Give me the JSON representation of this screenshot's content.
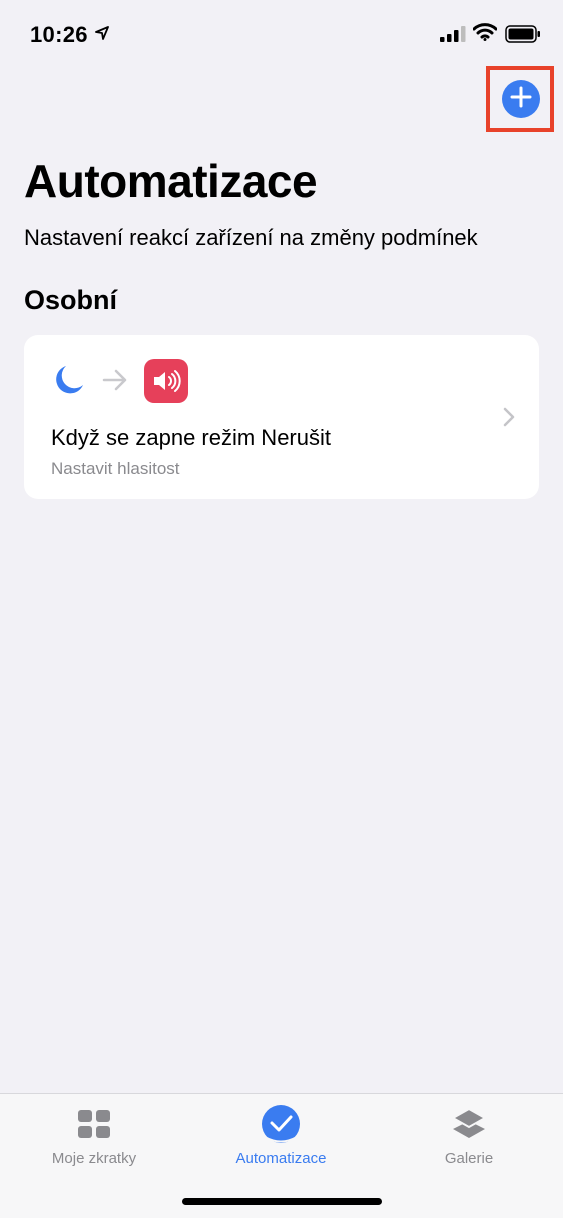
{
  "status_bar": {
    "time": "10:26"
  },
  "header": {
    "title": "Automatizace",
    "subtitle": "Nastavení reakcí zařízení na změny podmínek"
  },
  "section": {
    "title": "Osobní"
  },
  "automation": {
    "title": "Když se zapne režim Nerušit",
    "subtitle": "Nastavit hlasitost",
    "trigger_icon": "moon-icon",
    "action_icon": "speaker-icon"
  },
  "tab_bar": {
    "tabs": [
      {
        "label": "Moje zkratky",
        "icon": "grid-icon",
        "active": false
      },
      {
        "label": "Automatizace",
        "icon": "checkmark-icon",
        "active": true
      },
      {
        "label": "Galerie",
        "icon": "layers-icon",
        "active": false
      }
    ]
  },
  "colors": {
    "accent": "#3a7cf0",
    "highlight": "#e8422a",
    "sound_app": "#e6405a",
    "background": "#f2f1f6"
  }
}
